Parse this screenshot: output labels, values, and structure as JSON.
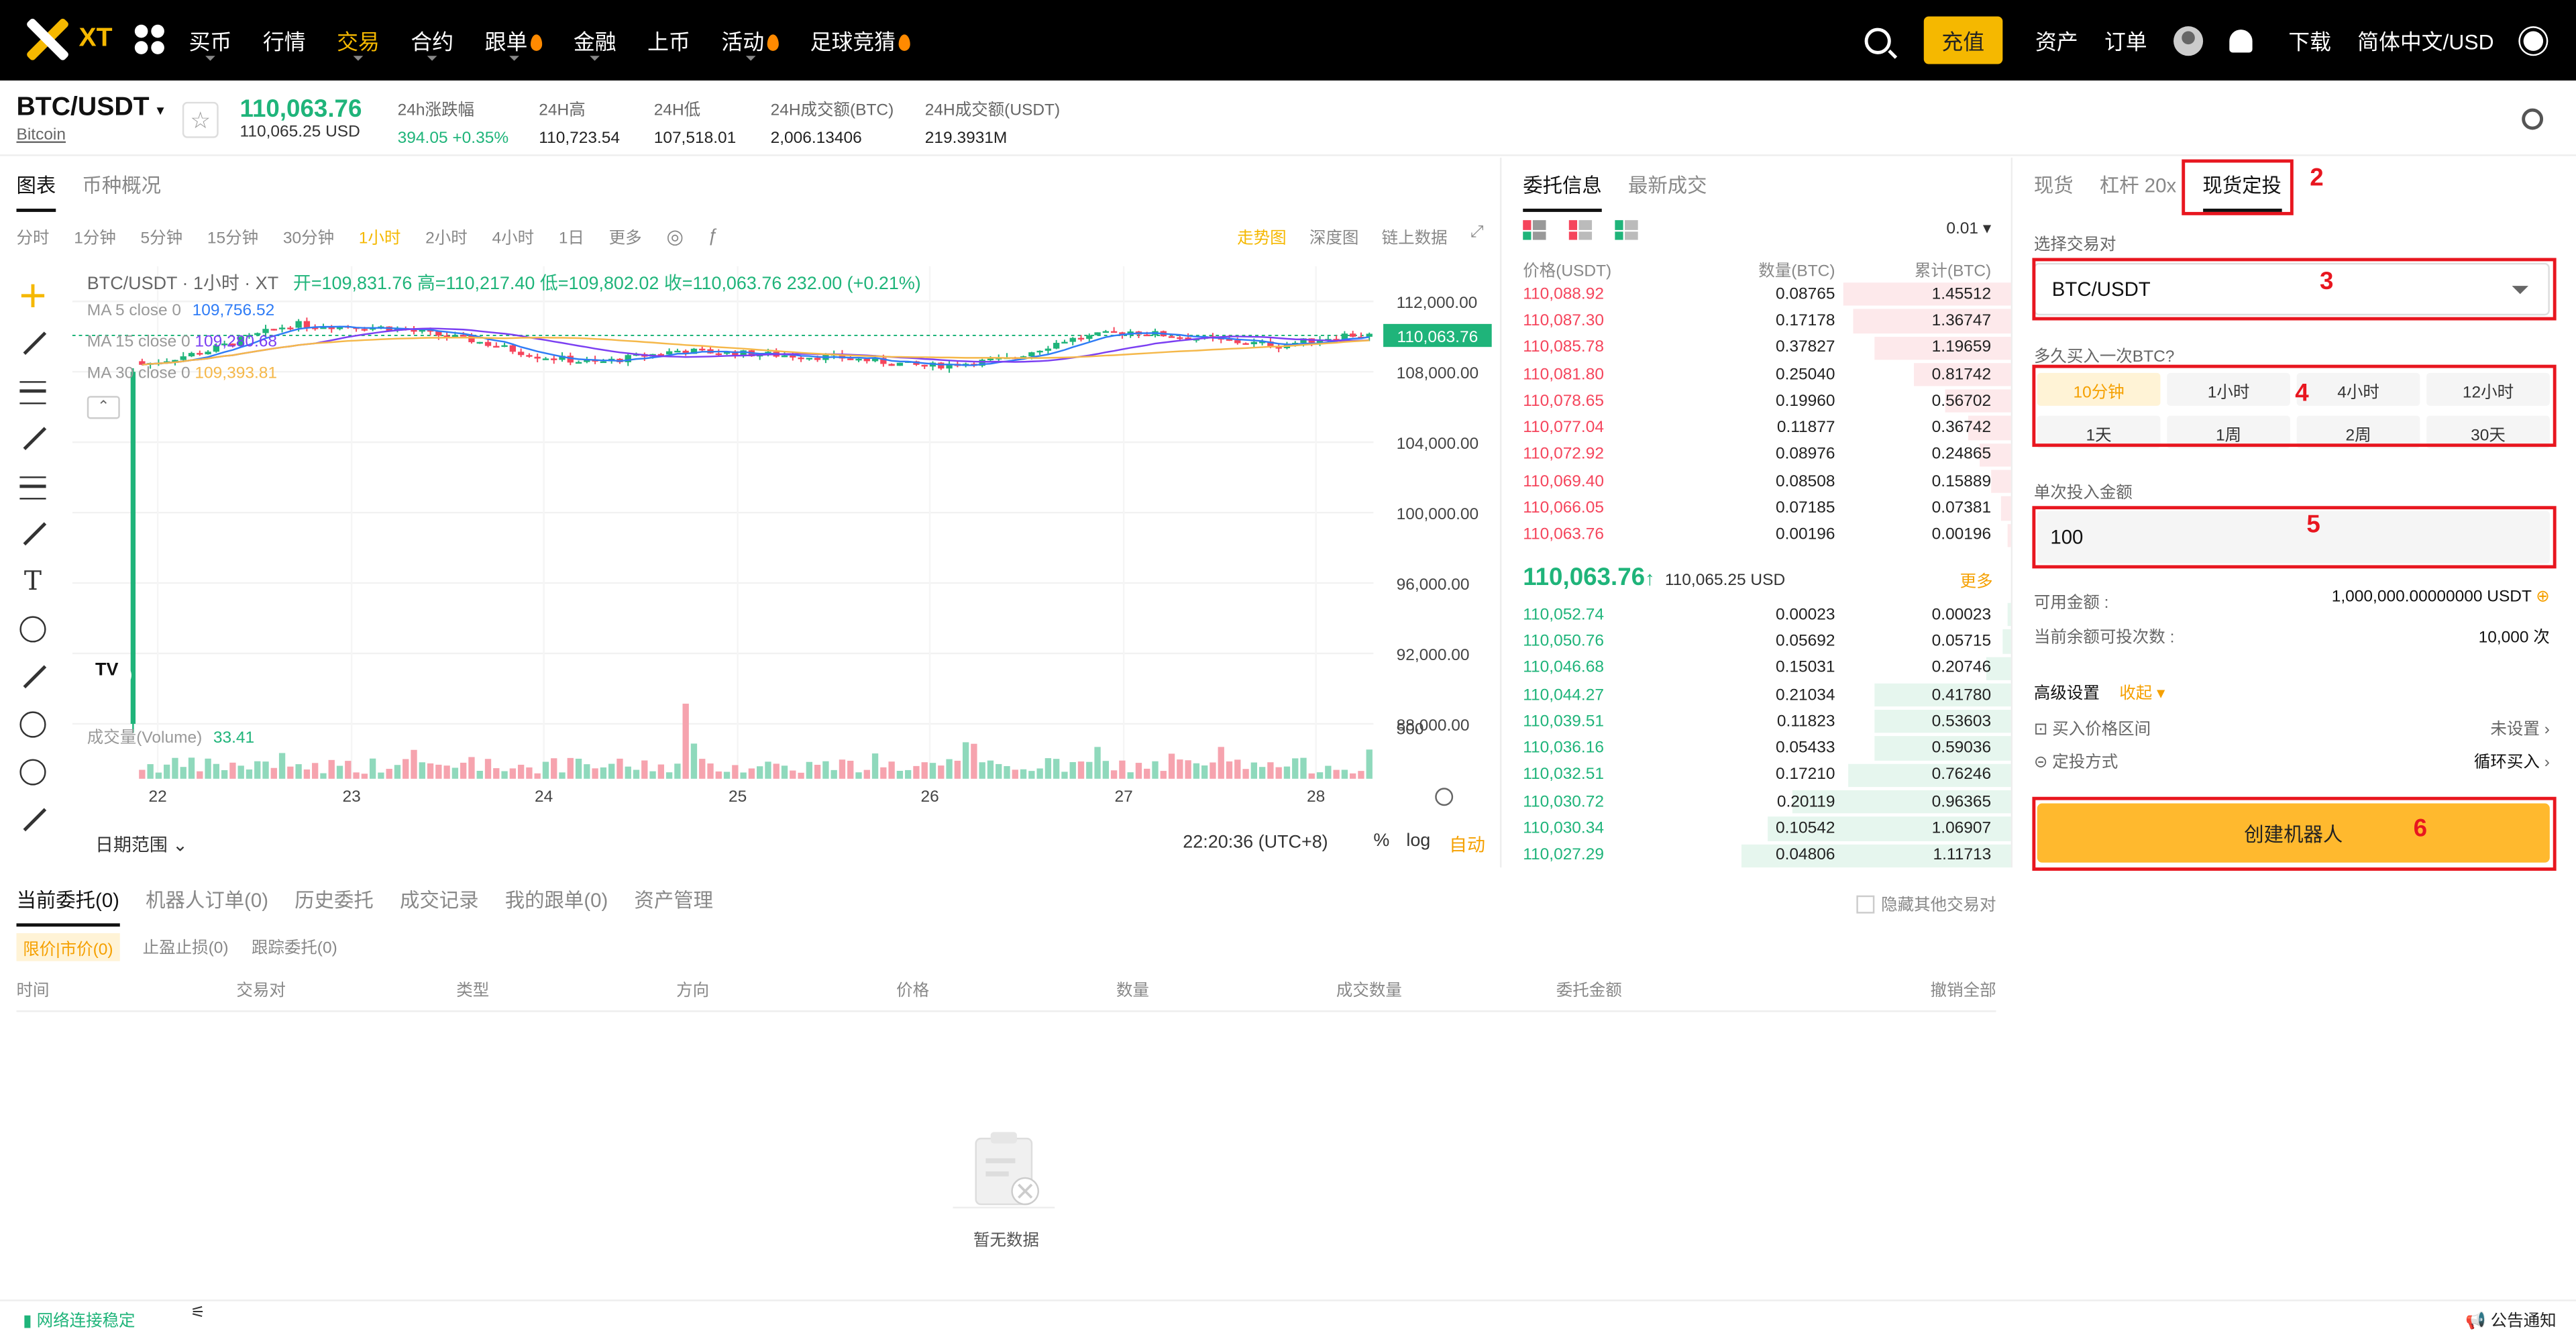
{
  "nav": {
    "brand": "XT",
    "items": [
      {
        "label": "买币",
        "active": false,
        "caret": true,
        "flame": false
      },
      {
        "label": "行情",
        "active": false,
        "caret": false,
        "flame": false
      },
      {
        "label": "交易",
        "active": true,
        "caret": true,
        "flame": false
      },
      {
        "label": "合约",
        "active": false,
        "caret": true,
        "flame": false
      },
      {
        "label": "跟单",
        "active": false,
        "caret": true,
        "flame": true
      },
      {
        "label": "金融",
        "active": false,
        "caret": true,
        "flame": false
      },
      {
        "label": "上币",
        "active": false,
        "caret": false,
        "flame": false
      },
      {
        "label": "活动",
        "active": false,
        "caret": true,
        "flame": true
      },
      {
        "label": "足球竞猜",
        "active": false,
        "caret": false,
        "flame": true
      }
    ],
    "deposit": "充值",
    "assets": "资产",
    "orders": "订单",
    "download": "下载",
    "lang": "简体中文/USD"
  },
  "ticker": {
    "symbol": "BTC/USDT",
    "subname": "Bitcoin",
    "price": "110,063.76",
    "price_usd": "110,065.25 USD",
    "stats": [
      {
        "label": "24h涨跌幅",
        "value": "394.05 +0.35%",
        "green": true
      },
      {
        "label": "24H高",
        "value": "110,723.54",
        "green": false
      },
      {
        "label": "24H低",
        "value": "107,518.01",
        "green": false
      },
      {
        "label": "24H成交额(BTC)",
        "value": "2,006.13406",
        "green": false
      },
      {
        "label": "24H成交额(USDT)",
        "value": "219.3931M",
        "green": false
      }
    ]
  },
  "chart_tabs": [
    "图表",
    "币种概况"
  ],
  "timeframes": [
    "分时",
    "1分钟",
    "5分钟",
    "15分钟",
    "30分钟",
    "1小时",
    "2小时",
    "4小时",
    "1日",
    "更多"
  ],
  "active_tf": "1小时",
  "chart_views": [
    "走势图",
    "深度图",
    "链上数据"
  ],
  "active_view": "走势图",
  "indicators": {
    "title": "BTC/USDT · 1小时 · XT",
    "ohlc": "开=109,831.76 高=110,217.40 低=109,802.02 收=110,063.76 232.00 (+0.21%)",
    "ma5_label": "MA 5 close 0",
    "ma5_value": "109,756.52",
    "ma15_label": "MA 15 close 0",
    "ma15_value": "109,280.68",
    "ma30_label": "MA 30 close 0",
    "ma30_value": "109,393.81",
    "volume_label": "成交量(Volume)",
    "volume_value": "33.41",
    "price_tag": "110,063.76",
    "vol_axis": "500"
  },
  "chart_data": {
    "type": "candlestick",
    "x_labels": [
      "22",
      "23",
      "24",
      "25",
      "26",
      "27",
      "28"
    ],
    "y_ticks": [
      112000,
      108000,
      104000,
      100000,
      96000,
      92000,
      88000
    ],
    "y_tick_labels": [
      "112,000.00",
      "108,000.00",
      "104,000.00",
      "100,000.00",
      "96,000.00",
      "92,000.00",
      "88,000.00"
    ],
    "ylim": [
      86000,
      114000
    ],
    "last_price": 110063.76,
    "series": [
      {
        "name": "MA 5 close 0",
        "color": "#2f7cf6"
      },
      {
        "name": "MA 15 close 0",
        "color": "#7b3ff2"
      },
      {
        "name": "MA 30 close 0",
        "color": "#f5b84a"
      }
    ]
  },
  "chart_bottom": {
    "date_range": "日期范围",
    "clock": "22:20:36 (UTC+8)",
    "pct": "%",
    "log": "log",
    "auto": "自动"
  },
  "orderbook": {
    "tabs": [
      "委托信息",
      "最新成交"
    ],
    "precision": "0.01",
    "headers": [
      "价格(USDT)",
      "数量(BTC)",
      "累计(BTC)"
    ],
    "asks": [
      [
        "110,088.92",
        "0.08765",
        "1.45512",
        0.33
      ],
      [
        "110,087.30",
        "0.17178",
        "1.36747",
        0.31
      ],
      [
        "110,085.78",
        "0.37827",
        "1.19659",
        0.27
      ],
      [
        "110,081.80",
        "0.25040",
        "0.81742",
        0.19
      ],
      [
        "110,078.65",
        "0.19960",
        "0.56702",
        0.13
      ],
      [
        "110,077.04",
        "0.11877",
        "0.36742",
        0.085
      ],
      [
        "110,072.92",
        "0.08976",
        "0.24865",
        0.06
      ],
      [
        "110,069.40",
        "0.08508",
        "0.15889",
        0.04
      ],
      [
        "110,066.05",
        "0.07185",
        "0.07381",
        0.02
      ],
      [
        "110,063.76",
        "0.00196",
        "0.00196",
        0.005
      ]
    ],
    "mid_price": "110,063.76",
    "mid_usd": "110,065.25 USD",
    "more": "更多",
    "bids": [
      [
        "110,052.74",
        "0.00023",
        "0.00023",
        0.005
      ],
      [
        "110,050.76",
        "0.05692",
        "0.05715",
        0.015
      ],
      [
        "110,046.68",
        "0.15031",
        "0.20746",
        0.05
      ],
      [
        "110,044.27",
        "0.21034",
        "0.41780",
        0.27
      ],
      [
        "110,039.51",
        "0.11823",
        "0.53603",
        0.27
      ],
      [
        "110,036.16",
        "0.05433",
        "0.59036",
        0.27
      ],
      [
        "110,032.51",
        "0.17210",
        "0.76246",
        0.32
      ],
      [
        "110,030.72",
        "0.20119",
        "0.96365",
        0.43
      ],
      [
        "110,030.34",
        "0.10542",
        "1.06907",
        0.48
      ],
      [
        "110,027.29",
        "0.04806",
        "1.11713",
        0.53
      ]
    ]
  },
  "dca": {
    "tabs": [
      "现货",
      "杠杆 20x",
      "现货定投"
    ],
    "pair_label": "选择交易对",
    "pair": "BTC/USDT",
    "freq_label": "多久买入一次BTC?",
    "freqs": [
      "10分钟",
      "1小时",
      "4小时",
      "12小时",
      "1天",
      "1周",
      "2周",
      "30天"
    ],
    "amount_label": "单次投入金额",
    "amount": "100",
    "avail_label": "可用金额 :",
    "avail": "1,000,000.00000000 USDT",
    "times_label": "当前余额可投次数 :",
    "times": "10,000 次",
    "advanced": "高级设置",
    "collapse": "收起",
    "range_label": "买入价格区间",
    "range_value": "未设置",
    "mode_label": "定投方式",
    "mode_value": "循环买入",
    "create": "创建机器人"
  },
  "annotations": [
    "2",
    "3",
    "4",
    "5",
    "6"
  ],
  "orders": {
    "tabs": [
      "当前委托(0)",
      "机器人订单(0)",
      "历史委托",
      "成交记录",
      "我的跟单(0)",
      "资产管理"
    ],
    "hide_label": "隐藏其他交易对",
    "subtabs": [
      "限价|市价(0)",
      "止盈止损(0)",
      "跟踪委托(0)"
    ],
    "headers": [
      "时间",
      "交易对",
      "类型",
      "方向",
      "价格",
      "数量",
      "成交数量",
      "委托金额",
      "撤销全部"
    ],
    "empty": "暂无数据"
  },
  "footer": {
    "status": "网络连接稳定",
    "notice": "公告通知"
  }
}
